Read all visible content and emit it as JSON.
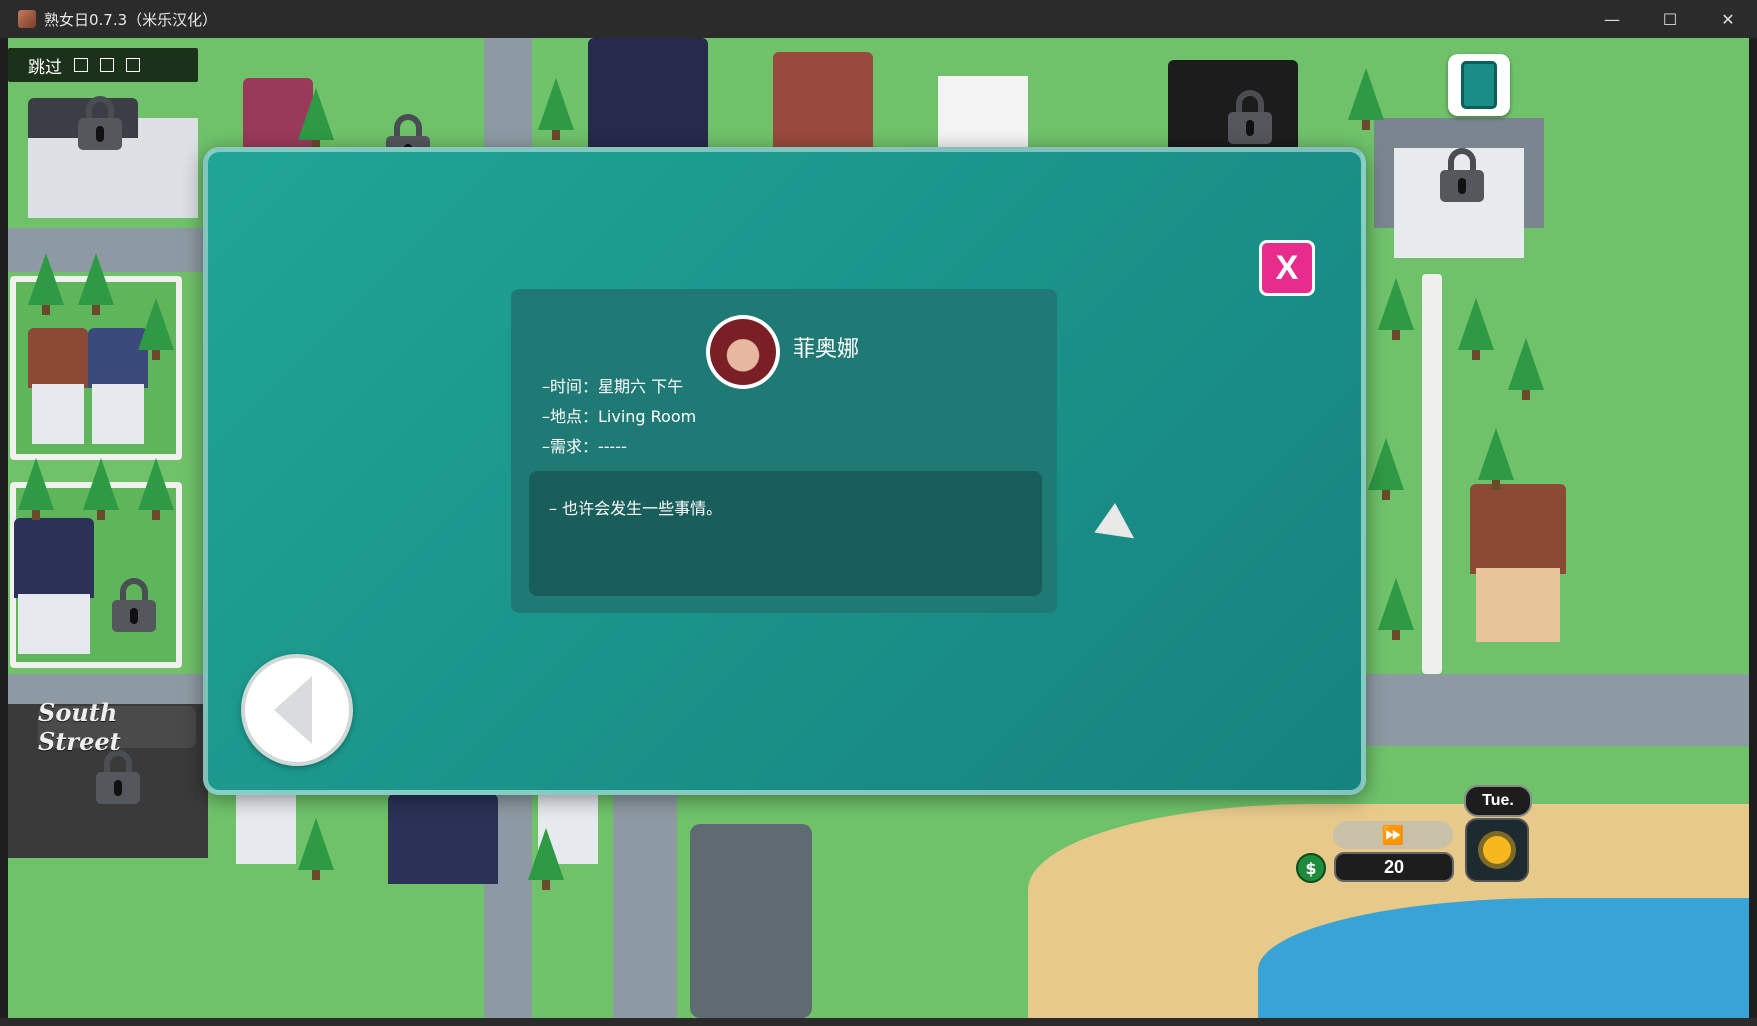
{
  "window": {
    "title": "熟女日0.7.3（米乐汉化）",
    "controls": {
      "minimize": "—",
      "maximize": "☐",
      "close": "✕"
    }
  },
  "hud": {
    "skip_label": "跳过",
    "phone_icon": "phone-icon",
    "day": "Tue.",
    "fast_forward_icon": "fast-forward-icon",
    "fast_forward_glyph": "⏩",
    "money_symbol": "$",
    "money": "20",
    "time_of_day_icon": "sun-icon"
  },
  "map": {
    "street_sign": "South Street"
  },
  "dialog": {
    "close_label": "X",
    "character_name": "菲奥娜",
    "time": "–时间：星期六 下午",
    "location": "–地点：Living Room",
    "requirement": "–需求：-----",
    "description": "– 也许会发生一些事情。"
  },
  "colors": {
    "modal_bg": "#1fa596",
    "card_bg": "#1f7a76",
    "desc_bg": "#1a5e5b",
    "close_button": "#e82c8c"
  }
}
